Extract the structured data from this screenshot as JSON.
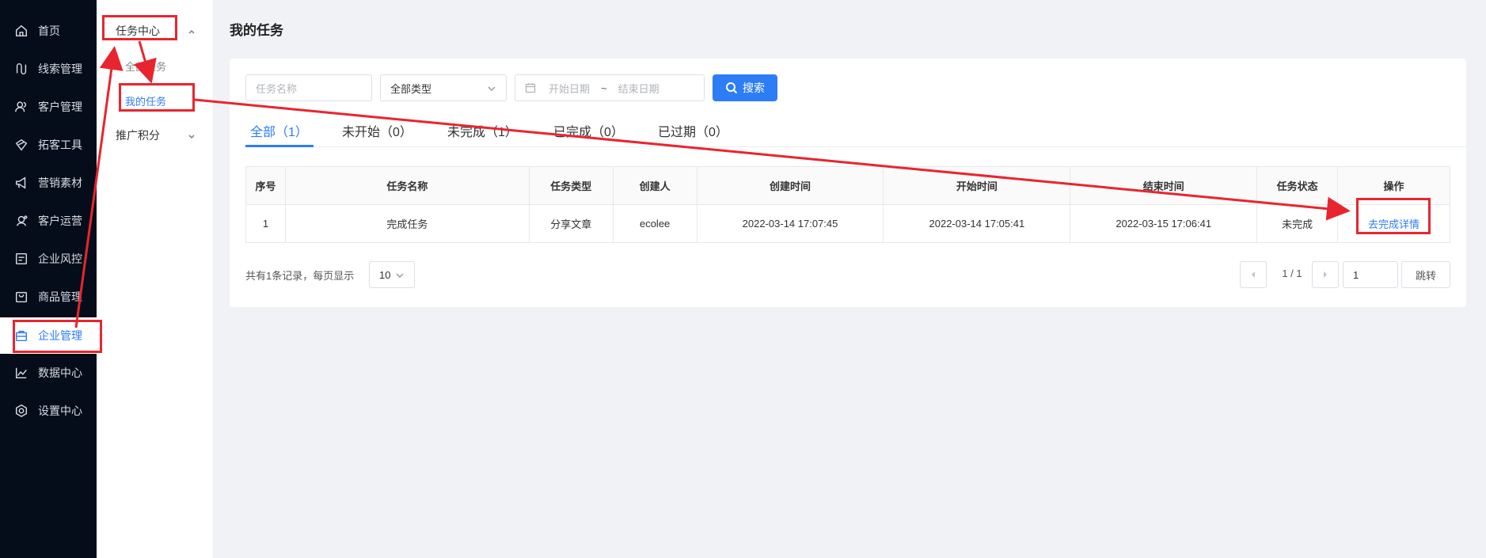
{
  "sidebar": {
    "items": [
      {
        "label": "首页",
        "icon": "home-icon"
      },
      {
        "label": "线索管理",
        "icon": "clue-icon"
      },
      {
        "label": "客户管理",
        "icon": "users-icon"
      },
      {
        "label": "拓客工具",
        "icon": "tool-icon"
      },
      {
        "label": "营销素材",
        "icon": "megaphone-icon"
      },
      {
        "label": "客户运营",
        "icon": "operation-icon"
      },
      {
        "label": "企业风控",
        "icon": "risk-icon"
      },
      {
        "label": "商品管理",
        "icon": "bag-icon"
      },
      {
        "label": "企业管理",
        "icon": "briefcase-icon"
      },
      {
        "label": "数据中心",
        "icon": "chart-line-icon"
      },
      {
        "label": "设置中心",
        "icon": "settings-icon"
      }
    ],
    "active_index": 8
  },
  "submenu": {
    "group1": "任务中心",
    "items": [
      "全部任务",
      "我的任务"
    ],
    "group2": "推广积分"
  },
  "page": {
    "title": "我的任务"
  },
  "filters": {
    "task_name_placeholder": "任务名称",
    "type_value": "全部类型",
    "start_date_placeholder": "开始日期",
    "date_separator": "~",
    "end_date_placeholder": "结束日期",
    "search_label": "搜索"
  },
  "tabs": [
    "全部（1）",
    "未开始（0）",
    "未完成（1）",
    "已完成（0）",
    "已过期（0）"
  ],
  "table": {
    "headers": [
      "序号",
      "任务名称",
      "任务类型",
      "创建人",
      "创建时间",
      "开始时间",
      "结束时间",
      "任务状态",
      "操作"
    ],
    "rows": [
      [
        "1",
        "完成任务",
        "分享文章",
        "ecolee",
        "2022-03-14 17:07:45",
        "2022-03-14 17:05:41",
        "2022-03-15 17:06:41",
        "未完成",
        "去完成详情"
      ]
    ]
  },
  "footer": {
    "summary": "共有1条记录，每页显示",
    "page_size": "10",
    "page_info": "1 / 1",
    "jump_value": "1",
    "jump_label": "跳转"
  },
  "colors": {
    "accent": "#2d7df6",
    "sidebar_bg": "#050d1a",
    "annotation": "#e8252f"
  }
}
